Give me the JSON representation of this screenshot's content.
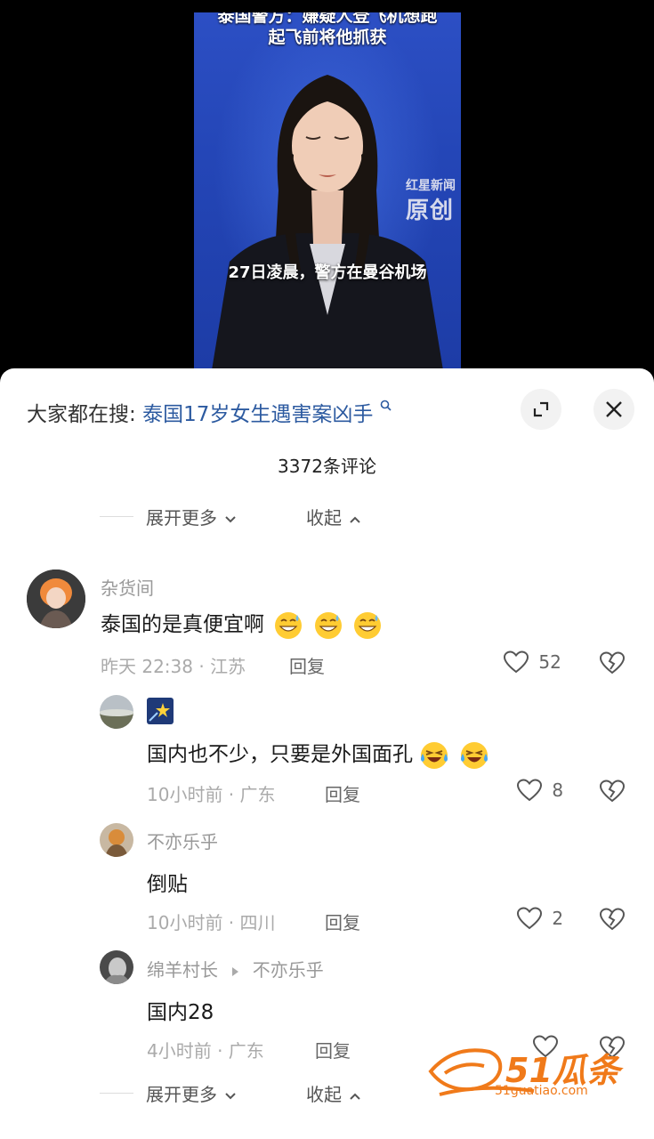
{
  "video": {
    "headline_line1": "泰国警方：嫌疑人登飞机想跑",
    "headline_line2": "起飞前将他抓获",
    "watermark_small": "红星新闻",
    "watermark_large": "原创",
    "subtitle": "27日凌晨，警方在曼谷机场"
  },
  "sheet": {
    "search_prefix": "大家都在搜:",
    "search_query": "泰国17岁女生遇害案凶手",
    "comment_count": "3372条评论",
    "expand_more": "展开更多",
    "collapse": "收起"
  },
  "comments": [
    {
      "user": "杂货间",
      "text": "泰国的是真便宜啊",
      "emoji": [
        "grin-sweat",
        "grin-sweat",
        "grin-sweat"
      ],
      "time_loc": "昨天 22:38 · 江苏",
      "reply": "回复",
      "likes": "52"
    },
    {
      "user": "🌠",
      "text": "国内也不少，只要是外国面孔",
      "emoji": [
        "laugh-cry",
        "laugh-cry"
      ],
      "time_loc": "10小时前 · 广东",
      "reply": "回复",
      "likes": "8"
    },
    {
      "user": "不亦乐乎",
      "text": "倒贴",
      "time_loc": "10小时前 · 四川",
      "reply": "回复",
      "likes": "2"
    },
    {
      "user": "绵羊村长",
      "reply_to": "不亦乐乎",
      "text": "国内28",
      "time_loc": "4小时前 · 广东",
      "reply": "回复",
      "likes": ""
    }
  ],
  "site_watermark": {
    "name": "51瓜条",
    "url": "51guatiao.com"
  },
  "colors": {
    "link_blue": "#2c5aa0",
    "watermark_orange": "#f07a1a",
    "video_blue": "#2446b7"
  }
}
